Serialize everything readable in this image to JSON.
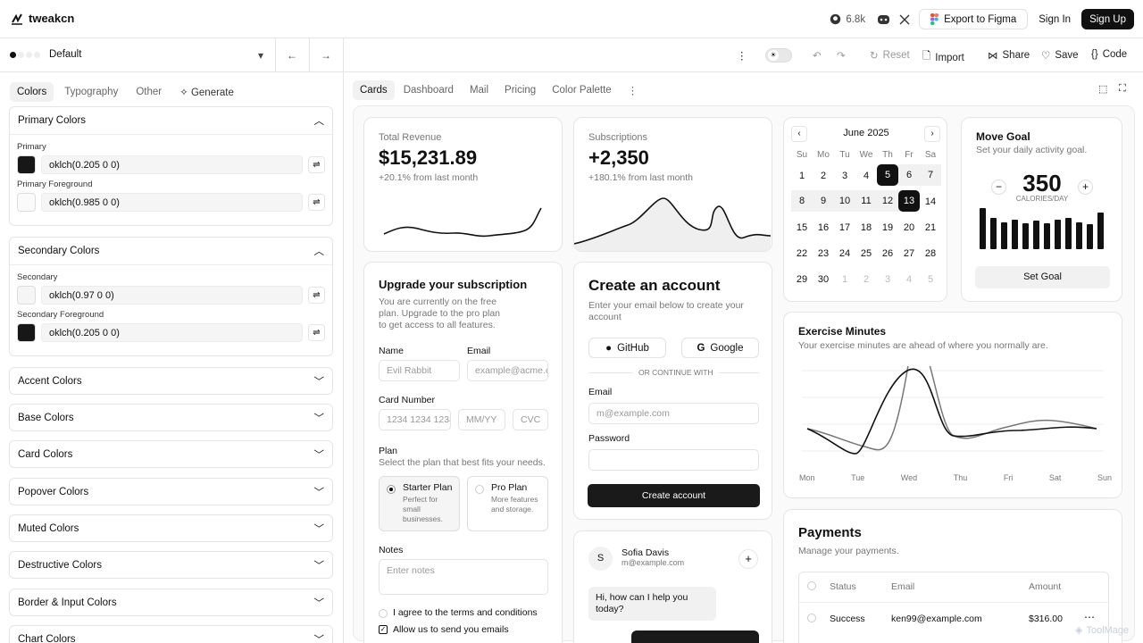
{
  "app": {
    "name": "tweakcn"
  },
  "header": {
    "github_stars": "6.8k",
    "export_label": "Export to Figma",
    "signin_label": "Sign In",
    "signup_label": "Sign Up"
  },
  "theme": {
    "name": "Default"
  },
  "sidebar": {
    "tabs": [
      "Colors",
      "Typography",
      "Other",
      "Generate"
    ],
    "primary": {
      "title": "Primary Colors",
      "fields": [
        {
          "label": "Primary",
          "value": "oklch(0.205 0 0)",
          "color": "#171717"
        },
        {
          "label": "Primary Foreground",
          "value": "oklch(0.985 0 0)",
          "color": "#fafafa"
        }
      ]
    },
    "secondary": {
      "title": "Secondary Colors",
      "fields": [
        {
          "label": "Secondary",
          "value": "oklch(0.97 0 0)",
          "color": "#f5f5f5"
        },
        {
          "label": "Secondary Foreground",
          "value": "oklch(0.205 0 0)",
          "color": "#171717"
        }
      ]
    },
    "collapsed": [
      "Accent Colors",
      "Base Colors",
      "Card Colors",
      "Popover Colors",
      "Muted Colors",
      "Destructive Colors",
      "Border & Input Colors",
      "Chart Colors"
    ]
  },
  "toolbar": {
    "reset": "Reset",
    "import": "Import",
    "share": "Share",
    "save": "Save",
    "code": "Code"
  },
  "main_tabs": [
    "Cards",
    "Dashboard",
    "Mail",
    "Pricing",
    "Color Palette"
  ],
  "revenue": {
    "label": "Total Revenue",
    "value": "$15,231.89",
    "delta": "+20.1% from last month"
  },
  "subs": {
    "label": "Subscriptions",
    "value": "+2,350",
    "delta": "+180.1% from last month"
  },
  "calendar": {
    "month": "June 2025",
    "weekdays": [
      "Su",
      "Mo",
      "Tu",
      "We",
      "Th",
      "Fr",
      "Sa"
    ],
    "days": [
      "1",
      "2",
      "3",
      "4",
      "5",
      "6",
      "7",
      "8",
      "9",
      "10",
      "11",
      "12",
      "13",
      "14",
      "15",
      "16",
      "17",
      "18",
      "19",
      "20",
      "21",
      "22",
      "23",
      "24",
      "25",
      "26",
      "27",
      "28",
      "29",
      "30",
      "1",
      "2",
      "3",
      "4",
      "5"
    ]
  },
  "goal": {
    "title": "Move Goal",
    "subtitle": "Set your daily activity goal.",
    "value": "350",
    "unit": "CALORIES/DAY",
    "button": "Set Goal",
    "bars": [
      0.95,
      0.72,
      0.62,
      0.68,
      0.6,
      0.66,
      0.6,
      0.68,
      0.72,
      0.62,
      0.58,
      0.85
    ]
  },
  "upgrade": {
    "title": "Upgrade your subscription",
    "desc": "You are currently on the free plan. Upgrade to the pro plan to get access to all features.",
    "name_label": "Name",
    "name_ph": "Evil Rabbit",
    "email_label": "Email",
    "email_ph": "example@acme.com",
    "card_label": "Card Number",
    "card_ph": "1234 1234 1234 1234",
    "mm_ph": "MM/YY",
    "cvc_ph": "CVC",
    "plan_label": "Plan",
    "plan_desc": "Select the plan that best fits your needs.",
    "starter_title": "Starter Plan",
    "starter_desc": "Perfect for small businesses.",
    "pro_title": "Pro Plan",
    "pro_desc": "More features and storage.",
    "notes_label": "Notes",
    "notes_ph": "Enter notes",
    "terms": "I agree to the terms and conditions",
    "emails": "Allow us to send you emails"
  },
  "account": {
    "title": "Create an account",
    "desc": "Enter your email below to create your account",
    "github": "GitHub",
    "google": "Google",
    "or": "OR CONTINUE WITH",
    "email_label": "Email",
    "email_ph": "m@example.com",
    "password_label": "Password",
    "button": "Create account"
  },
  "chat": {
    "initial": "S",
    "name": "Sofia Davis",
    "email": "m@example.com",
    "message": "Hi, how can I help you today?"
  },
  "exercise": {
    "title": "Exercise Minutes",
    "subtitle": "Your exercise minutes are ahead of where you normally are.",
    "days": [
      "Mon",
      "Tue",
      "Wed",
      "Thu",
      "Fri",
      "Sat",
      "Sun"
    ]
  },
  "payments": {
    "title": "Payments",
    "subtitle": "Manage your payments.",
    "headers": [
      "Status",
      "Email",
      "Amount"
    ],
    "rows": [
      {
        "status": "Success",
        "email": "ken99@example.com",
        "amount": "$316.00"
      }
    ]
  },
  "watermark": "ToolMage"
}
